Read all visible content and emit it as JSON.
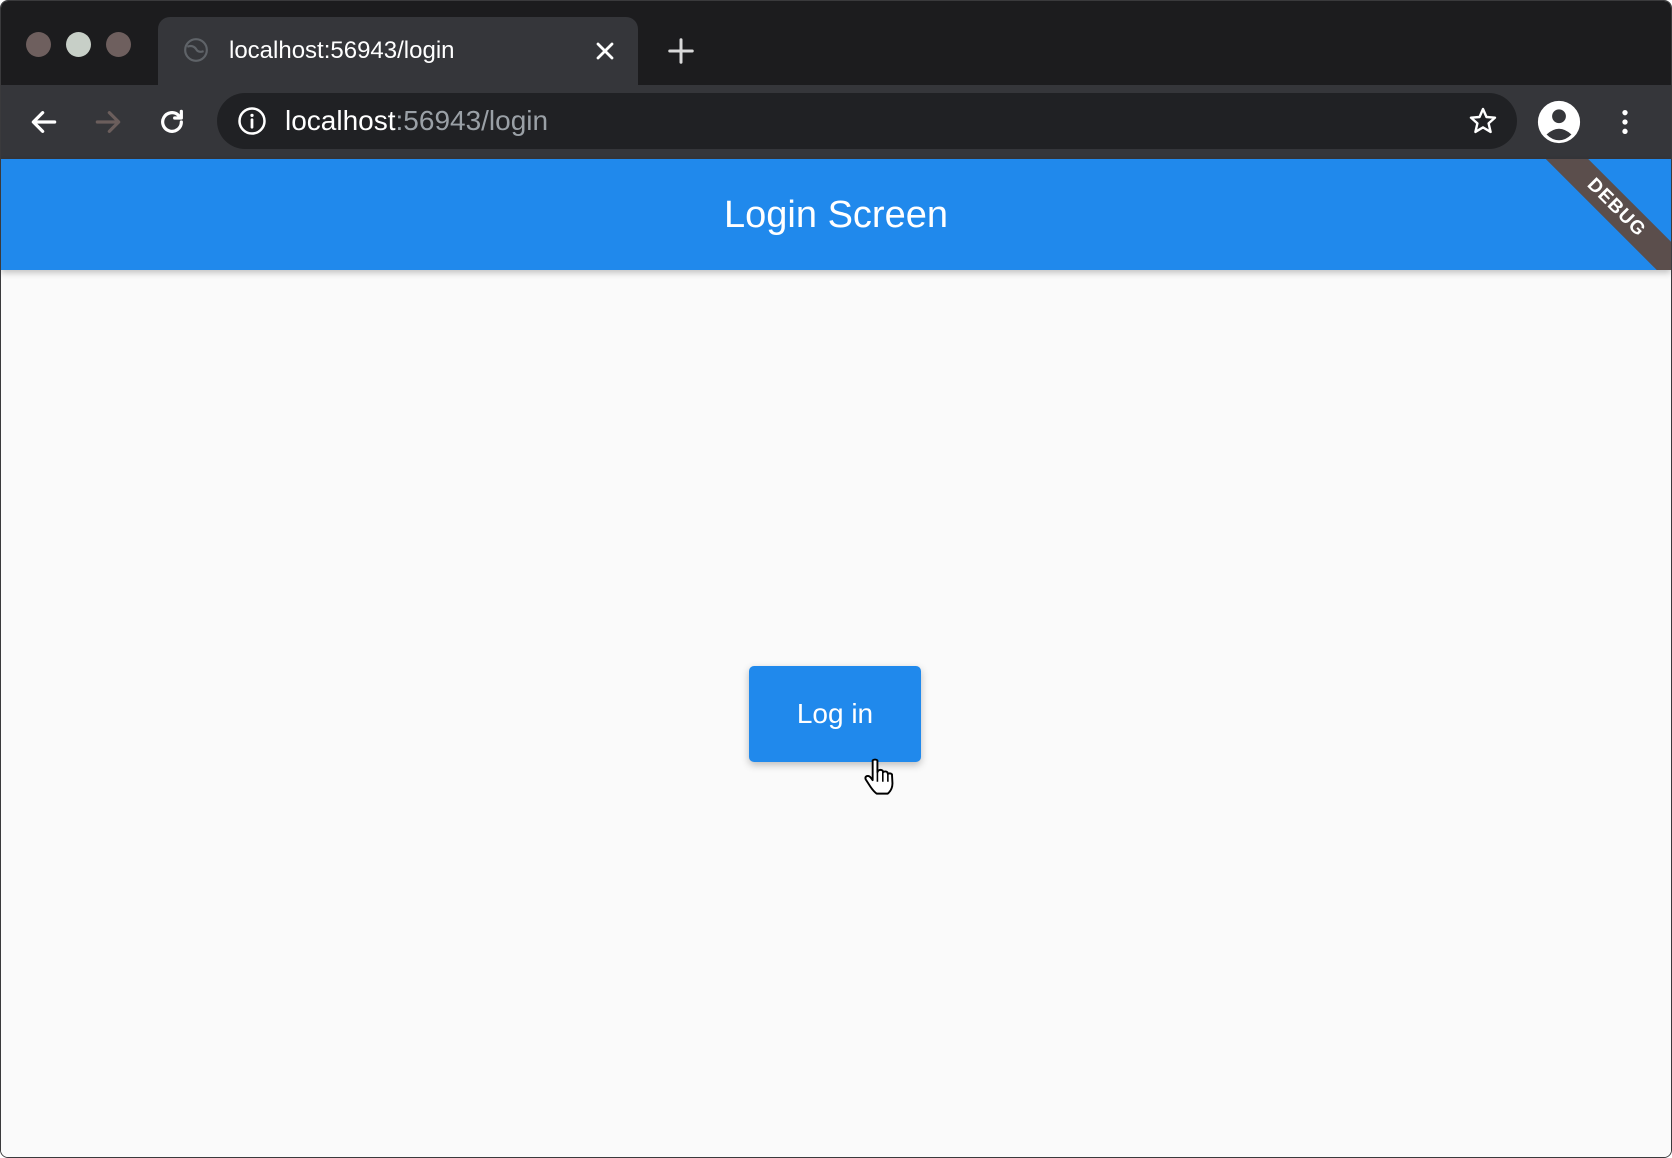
{
  "browser": {
    "tab": {
      "title": "localhost:56943/login"
    },
    "address_bar": {
      "host": "localhost",
      "path": ":56943/login"
    }
  },
  "app": {
    "appbar_title": "Login Screen",
    "debug_banner": "DEBUG",
    "login_button_label": "Log in"
  },
  "colors": {
    "primary": "#2089ec",
    "background": "#fafafa",
    "browser_frame": "#35363a"
  }
}
